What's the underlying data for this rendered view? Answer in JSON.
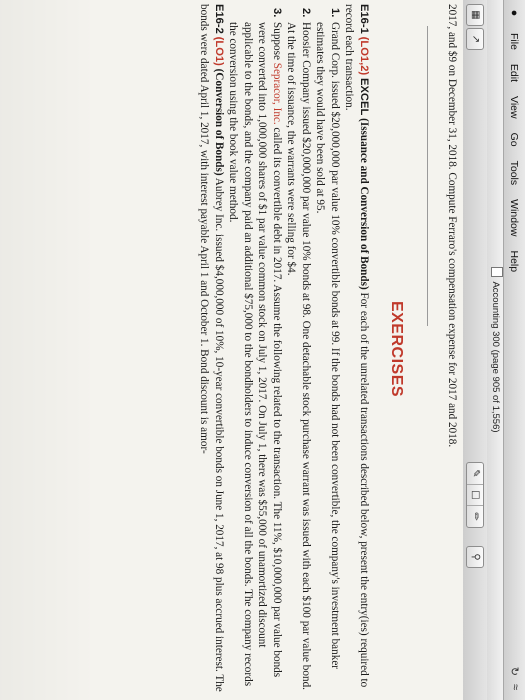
{
  "menubar": {
    "items": [
      "File",
      "Edit",
      "View",
      "Go",
      "Tools",
      "Window",
      "Help"
    ]
  },
  "window": {
    "title": "Accounting 300 (page 905 of 1,556)"
  },
  "page": {
    "intro": "2017, and $9 on December 31, 2018. Compute Ferraro's compensation expense for 2017 and 2018.",
    "heading": "EXERCISES",
    "exercise1": {
      "number": "E16-1",
      "code": "(LO1,2)",
      "tag": "EXCEL",
      "title": "(Issuance and Conversion of Bonds)",
      "text": "For each of the unrelated transactions described below, present the entry(ies) required to record each transaction.",
      "items": [
        {
          "num": "1.",
          "text": "Grand Corp. issued $20,000,000 par value 10% convertible bonds at 99. If the bonds had not been convertible, the company's investment banker estimates they would have been sold at 95."
        },
        {
          "num": "2.",
          "text": "Hoosier Company issued $20,000,000 par value 10% bonds at 98. One detachable stock purchase warrant was issued with each $100 par value bond. At the time of issuance, the warrants were selling for $4."
        },
        {
          "num": "3.",
          "prefix": "Suppose",
          "company": "Sepracor, Inc.",
          "text": "called its convertible debt in 2017. Assume the following related to the transaction. The 11%, $10,000,000 par value bonds were converted into 1,000,000 shares of $1 par value common stock on July 1, 2017. On July 1, there was $55,000 of unamortized discount applicable to the bonds, and the company paid an additional $75,000 to the bondholders to induce conversion of all the bonds. The company records the conversion using the book value method."
        }
      ]
    },
    "exercise2": {
      "number": "E16-2",
      "code": "(LO1)",
      "title": "(Conversion of Bonds)",
      "text": "Aubrey Inc. issued $4,000,000 of 10%, 10-year convertible bonds on June 1, 2017, at 98 plus accrued interest. The bonds were dated April 1, 2017, with interest payable April 1 and October 1. Bond discount is amor-"
    }
  }
}
